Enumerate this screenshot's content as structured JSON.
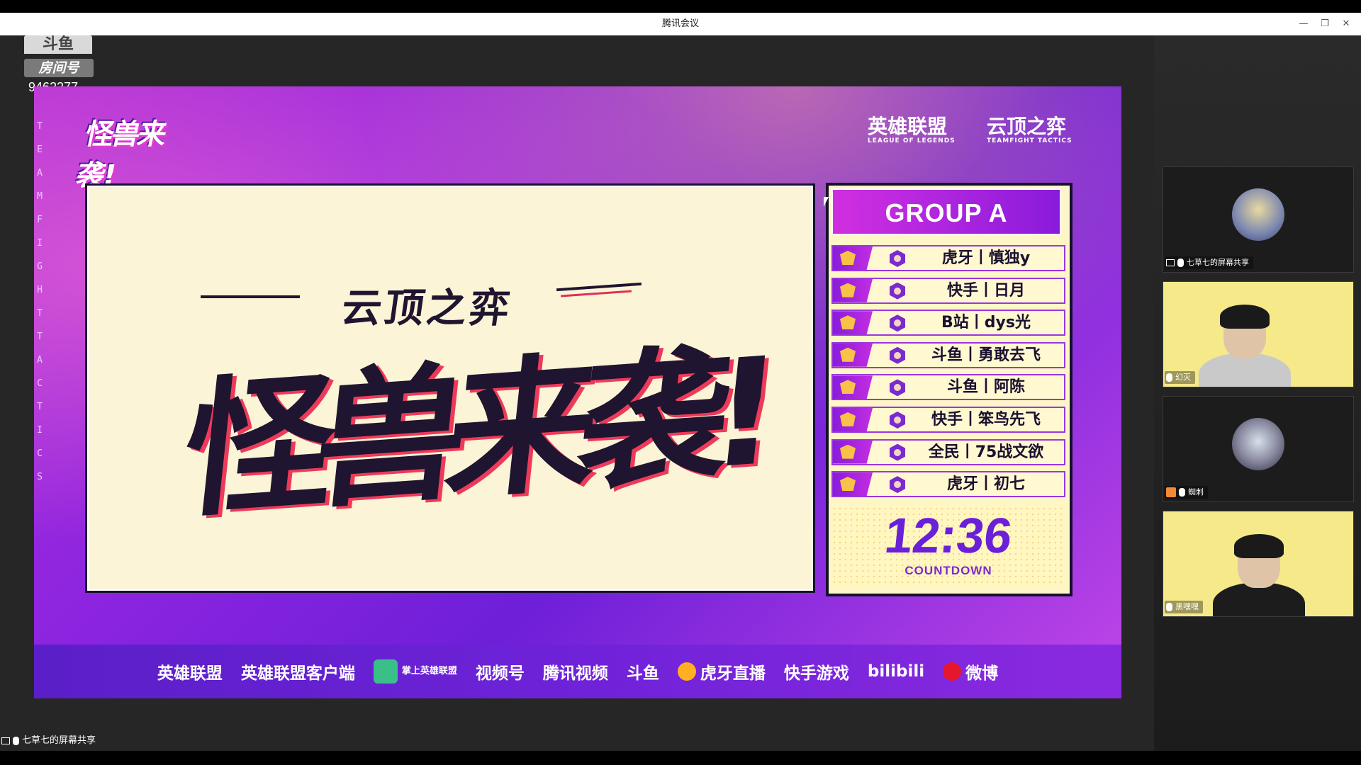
{
  "window": {
    "title": "腾讯会议",
    "controls": [
      "—",
      "❐",
      "✕"
    ]
  },
  "watermark": {
    "logo": "斗鱼",
    "room_label": "房间号",
    "room_number": "9462277"
  },
  "stream": {
    "vertical_text": "TEAMFIGHT TACTICS",
    "show_logo": "怪兽来袭!",
    "top_brands": [
      {
        "name": "英雄联盟",
        "sub": "LEAGUE OF LEGENDS"
      },
      {
        "name": "云顶之弈",
        "sub": "TEAMFIGHT TACTICS"
      }
    ],
    "panel": {
      "subtitle": "云顶之弈",
      "title": "怪兽来袭!"
    },
    "board": {
      "group": "GROUP A",
      "players": [
        "虎牙丨慎独y",
        "快手丨日月",
        "B站丨dys光",
        "斗鱼丨勇敢去飞",
        "斗鱼丨阿陈",
        "快手丨笨鸟先飞",
        "全民丨75战文欲",
        "虎牙丨初七"
      ],
      "countdown": "12:36",
      "countdown_label": "COUNTDOWN"
    },
    "sponsors": [
      "英雄联盟",
      "英雄联盟客户端",
      "掌上英雄联盟",
      "视频号",
      "腾讯视频",
      "斗鱼",
      "虎牙直播",
      "快手游戏",
      "bilibili",
      "微博"
    ]
  },
  "participants": [
    {
      "name": "七草七的屏幕共享",
      "type": "avatar",
      "icon": "screen-share-icon"
    },
    {
      "name": "幻灭",
      "type": "video",
      "icon": "mic-icon"
    },
    {
      "name": "蜘刺",
      "type": "avatar",
      "icon": "person-icon"
    },
    {
      "name": "黑嘿嘿",
      "type": "video",
      "icon": "mic-icon"
    }
  ],
  "share_label": "七草七的屏幕共享",
  "colors": {
    "purple": "#8a1bdc",
    "magenta": "#d12fe0",
    "cream": "#fbf4d6",
    "accent_red": "#ee3a5a"
  }
}
